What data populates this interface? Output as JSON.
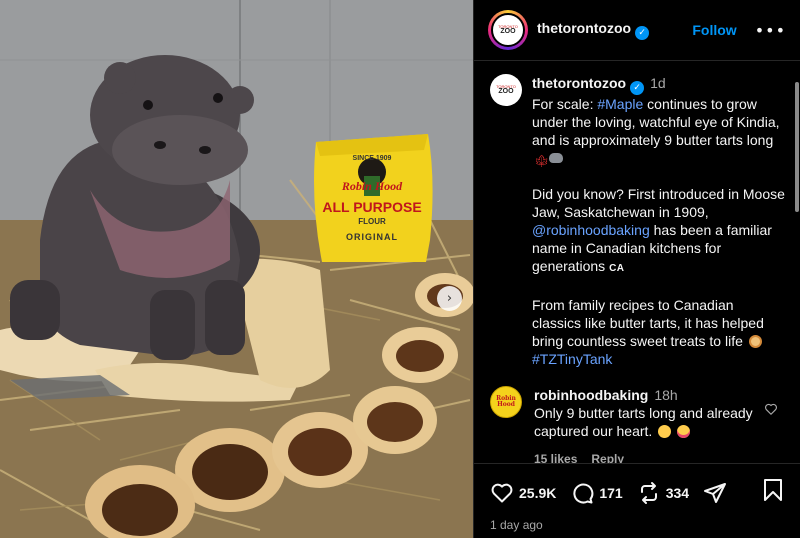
{
  "post": {
    "header": {
      "username": "thetorontozoo",
      "follow_label": "Follow",
      "more_label": "•••",
      "avatar_text_top": "TORONTO",
      "avatar_text_main": "ZOO"
    },
    "caption": {
      "username": "thetorontozoo",
      "time": "1d",
      "p1_pre": "For scale: ",
      "p1_link": "#Maple",
      "p1_post": " continues to grow under the loving, watchful eye of Kindia, and is approximately 9 butter tarts long",
      "p2_pre": "Did you know? First introduced in Moose Jaw, Saskatchewan in 1909, ",
      "p2_link": "@robinhoodbaking",
      "p2_post": " has been a familiar name in Canadian kitchens for generations ",
      "p2_flag": "CA",
      "p3": "From family recipes to Canadian classics like butter tarts, it has helped bring countless sweet treats to life ",
      "p3_tag": "#TZTinyTank"
    },
    "reply": {
      "username": "robinhoodbaking",
      "time": "18h",
      "text": "Only 9 butter tarts long and already captured our heart.",
      "likes": "15 likes",
      "reply_label": "Reply",
      "avatar_text": "Robin Hood"
    },
    "actions": {
      "likes": "25.9K",
      "comments": "171",
      "reposts": "334",
      "timestamp": "1 day ago"
    },
    "photo": {
      "bag_brand": "Robin Hood",
      "bag_line1": "ALL PURPOSE",
      "bag_line2": "FLOUR",
      "bag_line3": "ORIGINAL",
      "bag_small": "SINCE 1909",
      "next_icon": "›"
    }
  },
  "colors": {
    "link": "#6aa3ff",
    "follow": "#0095f6",
    "verified": "#0095f6",
    "bag_yellow": "#f2d21d",
    "brand_red": "#c0161d"
  },
  "icons": [
    "verified-icon",
    "more-icon",
    "heart-icon",
    "comment-icon",
    "repost-icon",
    "share-icon",
    "bookmark-icon",
    "chevron-right-icon"
  ]
}
